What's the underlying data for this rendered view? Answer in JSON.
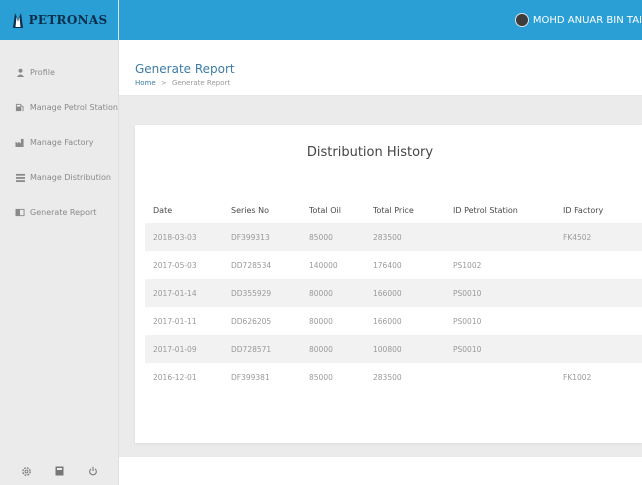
{
  "brand": {
    "logo_text": "PETRONAS",
    "accent": "#2a9fd6"
  },
  "user": {
    "name": "MOHD ANUAR BIN TAI"
  },
  "sidebar": {
    "items": [
      {
        "label": "Profile",
        "icon": "user-icon"
      },
      {
        "label": "Manage Petrol Station",
        "icon": "station-icon"
      },
      {
        "label": "Manage Factory",
        "icon": "factory-icon"
      },
      {
        "label": "Manage Distribution",
        "icon": "list-icon"
      },
      {
        "label": "Generate Report",
        "icon": "report-icon"
      }
    ],
    "footer_icons": [
      "settings-icon",
      "calculator-icon",
      "power-icon"
    ]
  },
  "header": {
    "title": "Generate Report",
    "breadcrumb": {
      "home": "Home",
      "separator": ">",
      "current": "Generate Report"
    }
  },
  "card": {
    "title": "Distribution History",
    "columns": [
      "Date",
      "Series No",
      "Total Oil",
      "Total Price",
      "ID Petrol Station",
      "ID Factory"
    ],
    "rows": [
      [
        "2018-03-03",
        "DF399313",
        "85000",
        "283500",
        "",
        "FK4502"
      ],
      [
        "2017-05-03",
        "DD728534",
        "140000",
        "176400",
        "PS1002",
        ""
      ],
      [
        "2017-01-14",
        "DD355929",
        "80000",
        "166000",
        "PS0010",
        ""
      ],
      [
        "2017-01-11",
        "DD626205",
        "80000",
        "166000",
        "PS0010",
        ""
      ],
      [
        "2017-01-09",
        "DD728571",
        "80000",
        "100800",
        "PS0010",
        ""
      ],
      [
        "2016-12-01",
        "DF399381",
        "85000",
        "283500",
        "",
        "FK1002"
      ]
    ]
  }
}
